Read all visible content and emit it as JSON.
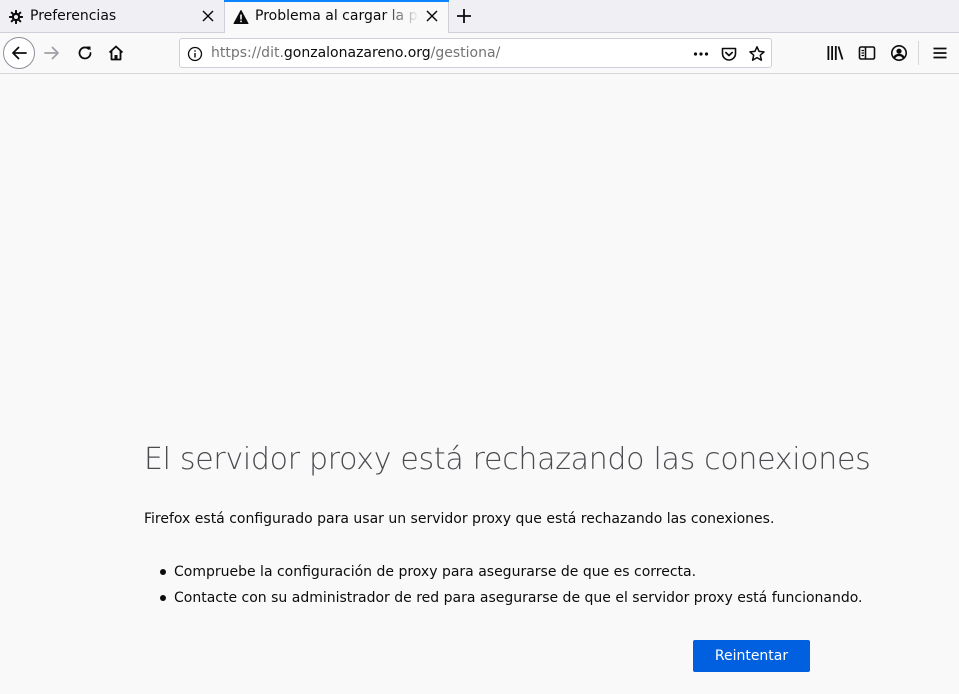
{
  "tabs": [
    {
      "label": "Preferencias",
      "icon": "gear-icon",
      "active": false
    },
    {
      "label": "Problema al cargar la página",
      "icon": "warning-icon",
      "active": true
    }
  ],
  "urlbar": {
    "scheme": "https://dit.",
    "host": "gonzalonazareno.org",
    "path": "/gestiona/"
  },
  "error": {
    "title": "El servidor proxy está rechazando las conexiones",
    "description": "Firefox está configurado para usar un servidor proxy que está rechazando las conexiones.",
    "items": [
      "Compruebe la configuración de proxy para asegurarse de que es correcta.",
      "Contacte con su administrador de red para asegurarse de que el servidor proxy está funcionando."
    ],
    "retry_label": "Reintentar"
  },
  "colors": {
    "accent": "#0a84ff",
    "button": "#0060df",
    "page_bg": "#f9f9fa"
  }
}
